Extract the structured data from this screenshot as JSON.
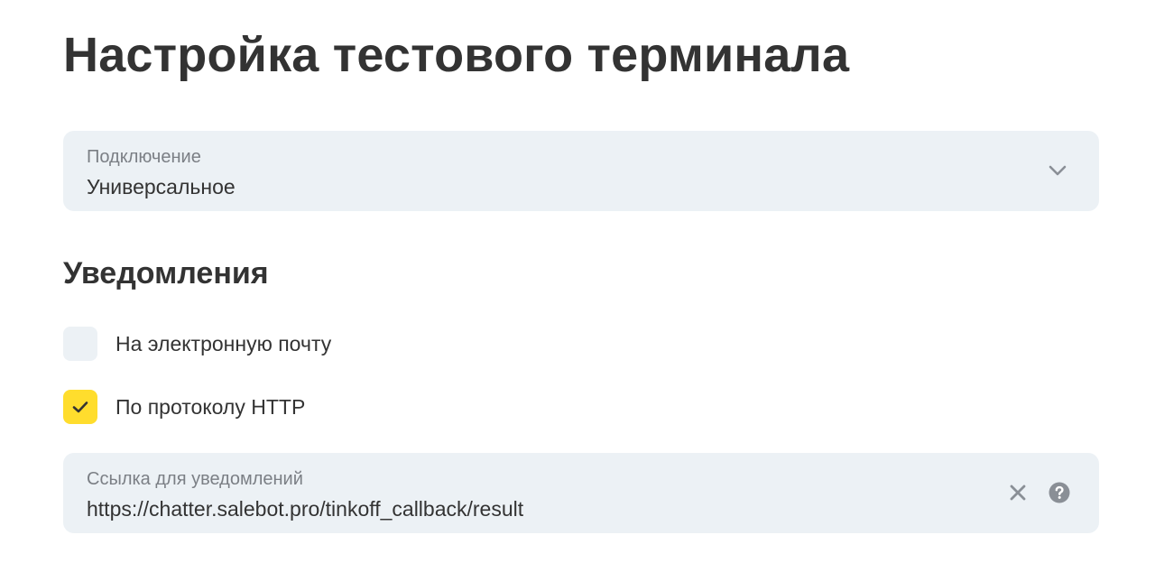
{
  "page": {
    "title": "Настройка тестового терминала"
  },
  "connection": {
    "label": "Подключение",
    "value": "Универсальное",
    "icon": "chevron-down-icon"
  },
  "notifications": {
    "title": "Уведомления",
    "options": [
      {
        "label": "На электронную почту",
        "checked": false
      },
      {
        "label": "По протоколу HTTP",
        "checked": true
      }
    ]
  },
  "callback_url": {
    "label": "Ссылка для уведомлений",
    "value": "https://chatter.salebot.pro/tinkoff_callback/result",
    "icons": [
      "close-icon",
      "help-icon"
    ]
  },
  "colors": {
    "field_background": "#ecf1f5",
    "checkbox_checked": "#ffdd2d",
    "text_primary": "#333333",
    "text_secondary": "#7b7f85",
    "icon_gray": "#8a8f96"
  }
}
